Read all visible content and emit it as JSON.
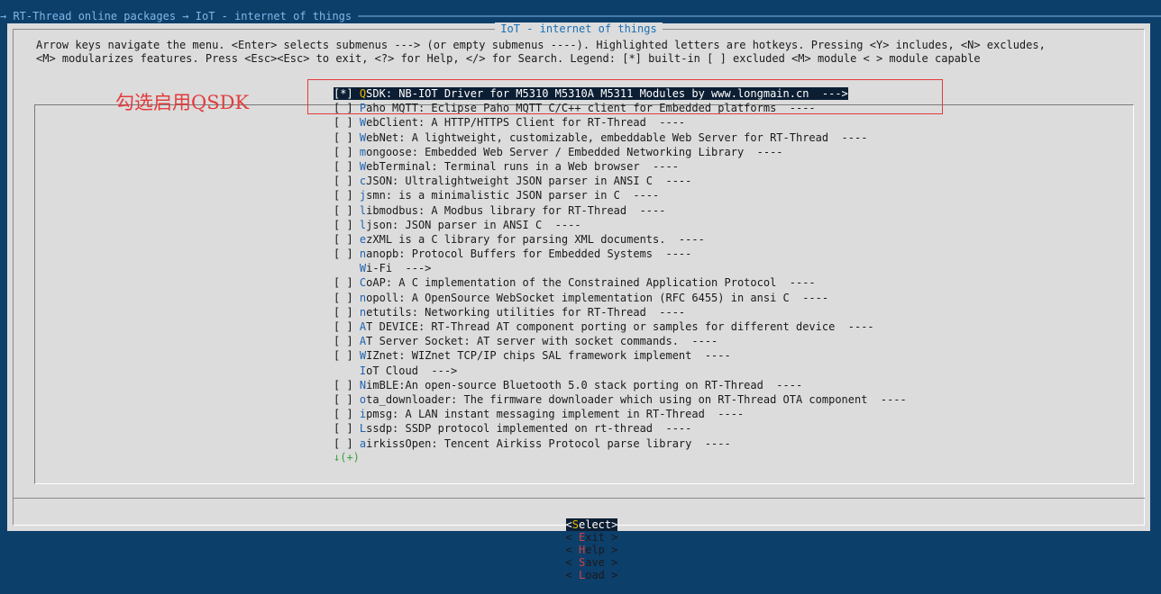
{
  "breadcrumb": "→ RT-Thread online packages → IoT - internet of things ──────────────────────────────────────────────────────────────────────────────────────────────────────────────────────────────────────────────────────────────",
  "dialog": {
    "title": "IoT - internet of things",
    "help_line1": "Arrow keys navigate the menu.  <Enter> selects submenus ---> (or empty submenus ----).  Highlighted letters are hotkeys.  Pressing <Y> includes, <N> excludes,",
    "help_line2": "<M> modularizes features.  Press <Esc><Esc> to exit, <?> for Help, </> for Search.  Legend: [*] built-in  [ ] excluded  <M> module  < > module capable"
  },
  "annotation": "勾选启用QSDK",
  "menu": {
    "items": [
      {
        "prefix": "[*] ",
        "hot": "Q",
        "rest": "SDK: NB-IOT Driver for M5310 M5310A M5311 Modules by www.longmain.cn  --->"
      },
      {
        "prefix": "[ ] ",
        "hot": "P",
        "rest": "aho MQTT: Eclipse Paho MQTT C/C++ client for Embedded platforms  ----"
      },
      {
        "prefix": "[ ] ",
        "hot": "W",
        "rest": "ebClient: A HTTP/HTTPS Client for RT-Thread  ----"
      },
      {
        "prefix": "[ ] ",
        "hot": "W",
        "rest": "ebNet: A lightweight, customizable, embeddable Web Server for RT-Thread  ----"
      },
      {
        "prefix": "[ ] ",
        "hot": "m",
        "rest": "ongoose: Embedded Web Server / Embedded Networking Library  ----"
      },
      {
        "prefix": "[ ] ",
        "hot": "W",
        "rest": "ebTerminal: Terminal runs in a Web browser  ----"
      },
      {
        "prefix": "[ ] ",
        "hot": "c",
        "rest": "JSON: Ultralightweight JSON parser in ANSI C  ----"
      },
      {
        "prefix": "[ ] ",
        "hot": "j",
        "rest": "smn: is a minimalistic JSON parser in C  ----"
      },
      {
        "prefix": "[ ] ",
        "hot": "l",
        "rest": "ibmodbus: A Modbus library for RT-Thread  ----"
      },
      {
        "prefix": "[ ] ",
        "hot": "l",
        "rest": "json: JSON parser in ANSI C  ----"
      },
      {
        "prefix": "[ ] ",
        "hot": "e",
        "rest": "zXML is a C library for parsing XML documents.  ----"
      },
      {
        "prefix": "[ ] ",
        "hot": "n",
        "rest": "anopb: Protocol Buffers for Embedded Systems  ----"
      },
      {
        "prefix": "    ",
        "hot": "W",
        "rest": "i-Fi  --->"
      },
      {
        "prefix": "[ ] ",
        "hot": "C",
        "rest": "oAP: A C implementation of the Constrained Application Protocol  ----"
      },
      {
        "prefix": "[ ] ",
        "hot": "n",
        "rest": "opoll: A OpenSource WebSocket implementation (RFC 6455) in ansi C  ----"
      },
      {
        "prefix": "[ ] ",
        "hot": "n",
        "rest": "etutils: Networking utilities for RT-Thread  ----"
      },
      {
        "prefix": "[ ] ",
        "hot": "A",
        "rest": "T DEVICE: RT-Thread AT component porting or samples for different device  ----"
      },
      {
        "prefix": "[ ] ",
        "hot": "A",
        "rest": "T Server Socket: AT server with socket commands.  ----"
      },
      {
        "prefix": "[ ] ",
        "hot": "W",
        "rest": "IZnet: WIZnet TCP/IP chips SAL framework implement  ----"
      },
      {
        "prefix": "    ",
        "hot": "I",
        "rest": "oT Cloud  --->"
      },
      {
        "prefix": "[ ] ",
        "hot": "N",
        "rest": "imBLE:An open-source Bluetooth 5.0 stack porting on RT-Thread  ----"
      },
      {
        "prefix": "[ ] ",
        "hot": "o",
        "rest": "ta_downloader: The firmware downloader which using on RT-Thread OTA component  ----"
      },
      {
        "prefix": "[ ] ",
        "hot": "i",
        "rest": "pmsg: A LAN instant messaging implement in RT-Thread  ----"
      },
      {
        "prefix": "[ ] ",
        "hot": "L",
        "rest": "ssdp: SSDP protocol implemented on rt-thread  ----"
      },
      {
        "prefix": "[ ] ",
        "hot": "a",
        "rest": "irkissOpen: Tencent Airkiss Protocol parse library  ----"
      }
    ],
    "more_indicator": "↓(+)"
  },
  "buttons": {
    "select": {
      "open": "<",
      "hot": "S",
      "rest": "elect>"
    },
    "exit": {
      "open": "< ",
      "hot": "E",
      "rest": "xit >"
    },
    "help": {
      "open": "< ",
      "hot": "H",
      "rest": "elp >"
    },
    "save": {
      "open": "< ",
      "hot": "S",
      "rest": "ave >"
    },
    "load": {
      "open": "< ",
      "hot": "L",
      "rest": "oad >"
    }
  }
}
